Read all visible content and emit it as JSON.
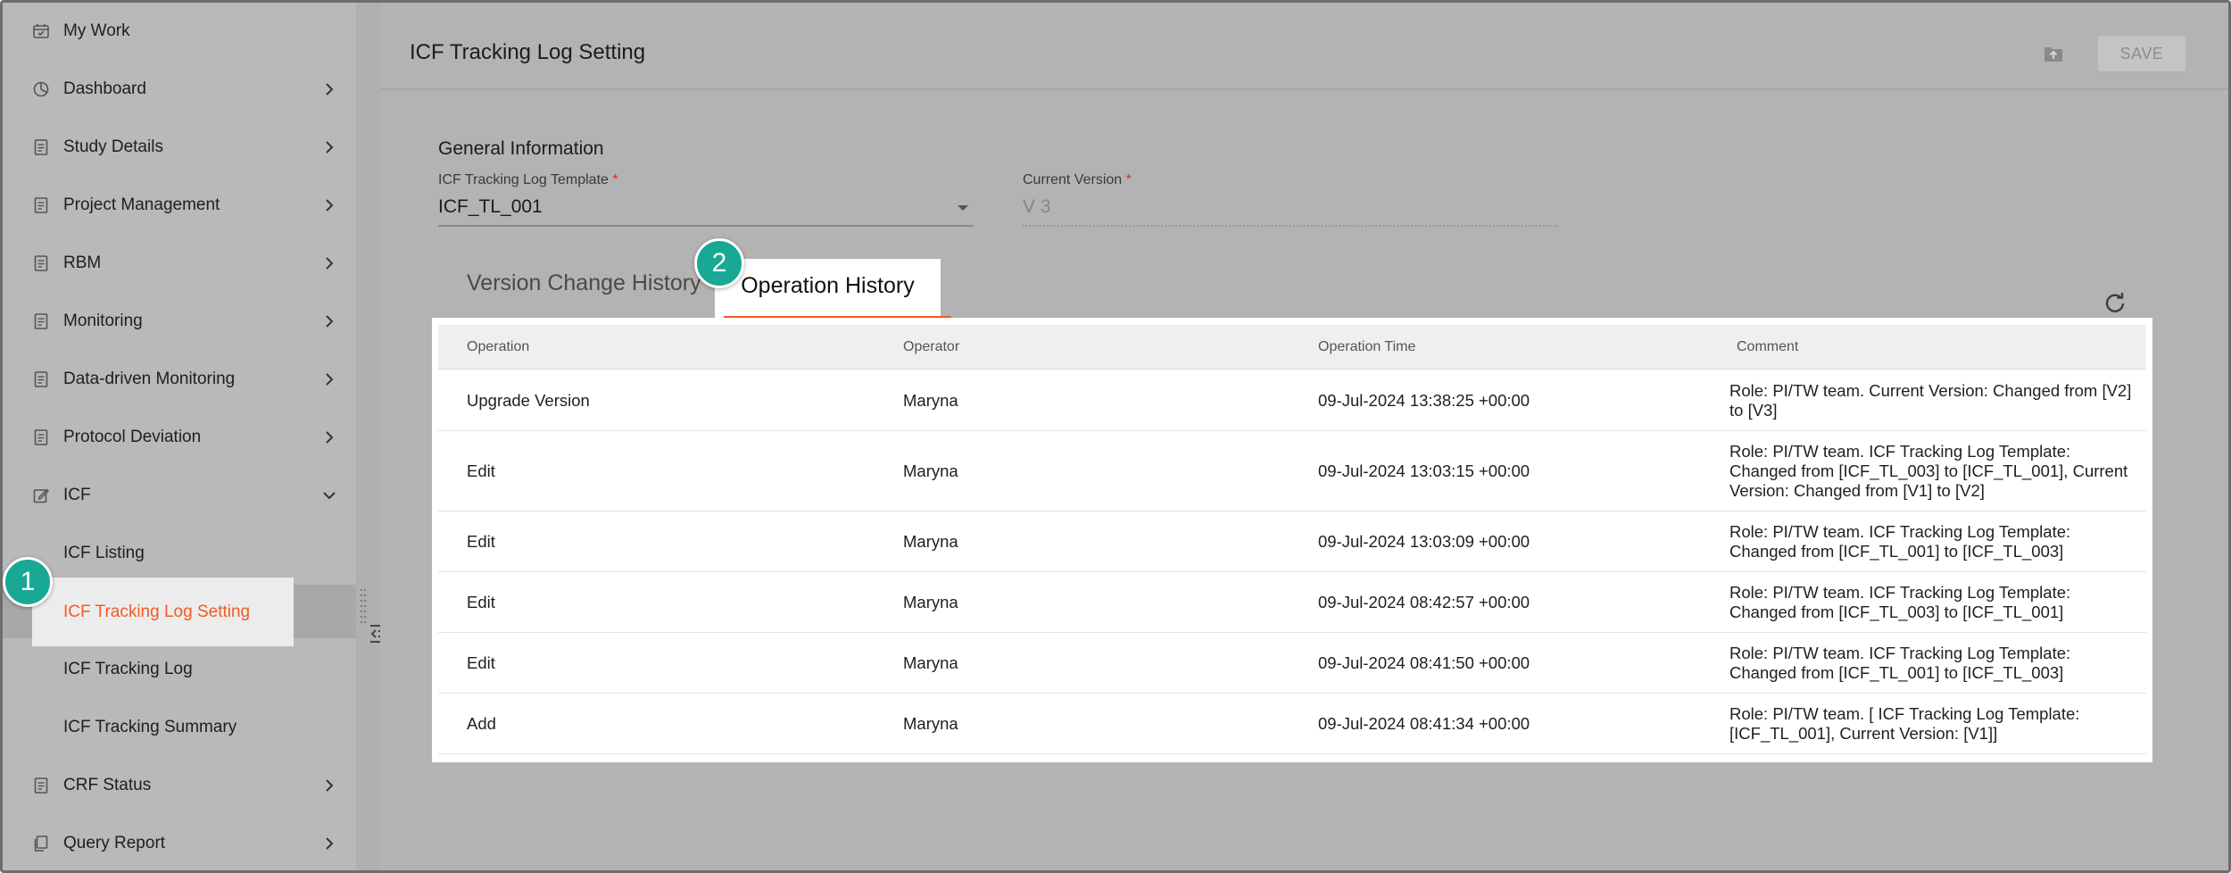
{
  "sidebar": {
    "items": [
      {
        "label": "My Work",
        "icon": "calendar-icon",
        "chevron": "none"
      },
      {
        "label": "Dashboard",
        "icon": "pie-chart-icon",
        "chevron": "right"
      },
      {
        "label": "Study Details",
        "icon": "document-icon",
        "chevron": "right"
      },
      {
        "label": "Project Management",
        "icon": "document-icon",
        "chevron": "right"
      },
      {
        "label": "RBM",
        "icon": "document-icon",
        "chevron": "right"
      },
      {
        "label": "Monitoring",
        "icon": "document-icon",
        "chevron": "right"
      },
      {
        "label": "Data-driven Monitoring",
        "icon": "document-icon",
        "chevron": "right"
      },
      {
        "label": "Protocol Deviation",
        "icon": "document-icon",
        "chevron": "right"
      },
      {
        "label": "ICF",
        "icon": "edit-icon",
        "chevron": "down"
      },
      {
        "label": "ICF Listing"
      },
      {
        "label": "ICF Tracking Log Setting",
        "active": true
      },
      {
        "label": "ICF Tracking Log"
      },
      {
        "label": "ICF Tracking Summary"
      },
      {
        "label": "CRF Status",
        "icon": "document-icon",
        "chevron": "right"
      },
      {
        "label": "Query Report",
        "icon": "copy-icon",
        "chevron": "right"
      }
    ]
  },
  "header": {
    "title": "ICF Tracking Log Setting",
    "save_label": "SAVE"
  },
  "general": {
    "section_title": "General Information",
    "template_label": "ICF Tracking Log Template",
    "template_value": "ICF_TL_001",
    "version_label": "Current Version",
    "version_value": "V 3",
    "required_mark": "*"
  },
  "tabs": [
    {
      "label": "Version Change History",
      "active": false
    },
    {
      "label": "Operation History",
      "active": true
    }
  ],
  "table": {
    "columns": [
      "Operation",
      "Operator",
      "Operation Time",
      "Comment"
    ],
    "rows": [
      {
        "operation": "Upgrade Version",
        "operator": "Maryna",
        "time": "09-Jul-2024 13:38:25 +00:00",
        "comment": "Role: PI/TW team. Current Version: Changed from [V2] to [V3]"
      },
      {
        "operation": "Edit",
        "operator": "Maryna",
        "time": "09-Jul-2024 13:03:15 +00:00",
        "comment": "Role: PI/TW team. ICF Tracking Log Template: Changed from [ICF_TL_003] to [ICF_TL_001], Current Version: Changed from [V1] to [V2]"
      },
      {
        "operation": "Edit",
        "operator": "Maryna",
        "time": "09-Jul-2024 13:03:09 +00:00",
        "comment": "Role: PI/TW team. ICF Tracking Log Template: Changed from [ICF_TL_001] to [ICF_TL_003]"
      },
      {
        "operation": "Edit",
        "operator": "Maryna",
        "time": "09-Jul-2024 08:42:57 +00:00",
        "comment": "Role: PI/TW team. ICF Tracking Log Template: Changed from [ICF_TL_003] to [ICF_TL_001]"
      },
      {
        "operation": "Edit",
        "operator": "Maryna",
        "time": "09-Jul-2024 08:41:50 +00:00",
        "comment": "Role: PI/TW team. ICF Tracking Log Template: Changed from [ICF_TL_001] to [ICF_TL_003]"
      },
      {
        "operation": "Add",
        "operator": "Maryna",
        "time": "09-Jul-2024 08:41:34 +00:00",
        "comment": "Role: PI/TW team. [ ICF Tracking Log Template: [ICF_TL_001], Current Version: [V1]]"
      }
    ]
  },
  "annotations": {
    "badge_1": "1",
    "badge_2": "2"
  },
  "colors": {
    "accent": "#f25a22",
    "badge": "#19a894",
    "overlay_gray": "#b3b3b3"
  }
}
